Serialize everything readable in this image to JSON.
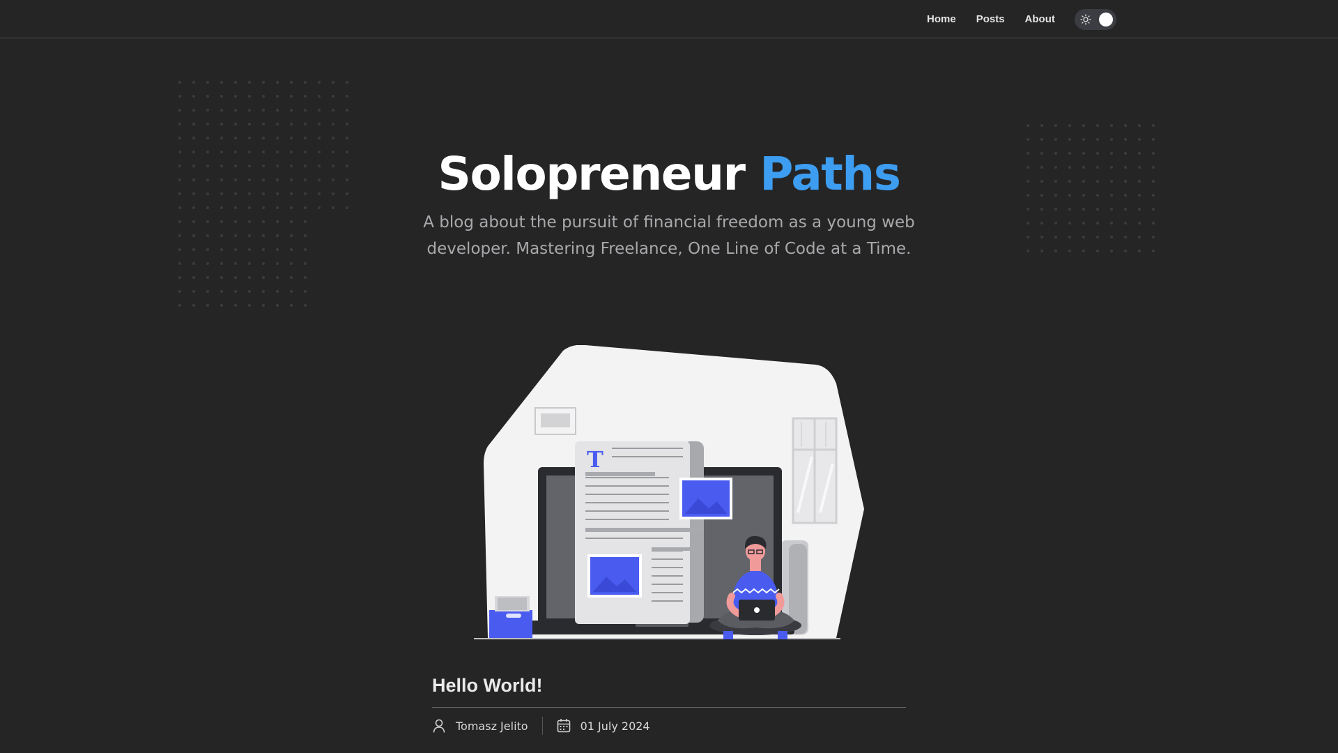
{
  "nav": {
    "links": [
      "Home",
      "Posts",
      "About"
    ],
    "theme_toggle": {
      "icon": "sun-icon",
      "state": "dark"
    }
  },
  "hero": {
    "title_main": "Solopreneur",
    "title_accent": "Paths",
    "subtitle": "A blog about the pursuit of financial freedom as a young web developer. Mastering Freelance, One Line of Code at a Time."
  },
  "post": {
    "title": "Hello World!",
    "author": "Tomasz Jelito",
    "date": "01 July 2024",
    "author_icon": "user-icon",
    "date_icon": "calendar-icon"
  },
  "colors": {
    "background": "#252526",
    "accent": "#3d9df0",
    "illustration_accent": "#4a5cf0"
  }
}
